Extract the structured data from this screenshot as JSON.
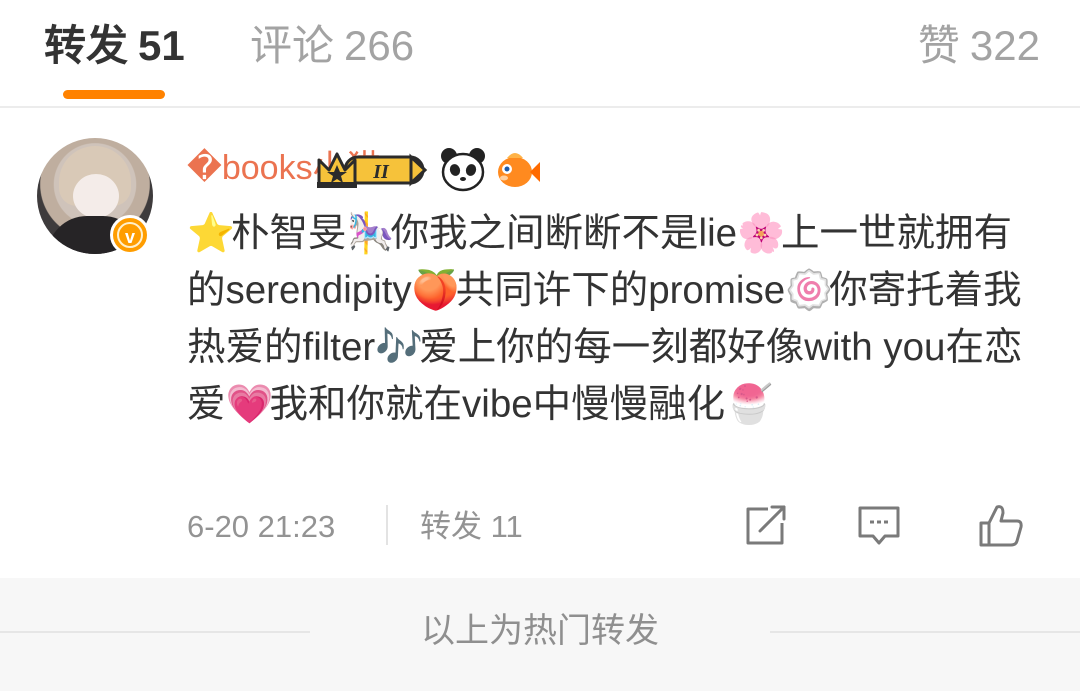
{
  "tabs": {
    "repost": {
      "label": "转发",
      "count": "51"
    },
    "comment": {
      "label": "评论",
      "count": "266"
    },
    "like": {
      "label": "赞",
      "count": "322"
    },
    "accent_color": "#ff8200"
  },
  "post": {
    "username": "�books小猫",
    "username_color": "#eb7350",
    "badges": [
      "crown-level-badge",
      "panda-icon",
      "fish-icon"
    ],
    "badge_level_text": "II",
    "verified_mark": "v",
    "content": {
      "seg1": "朴智旻",
      "seg2": "你我之间断断不是lie",
      "seg3": "上一世就拥有的serendipity",
      "seg4": "共同许下的promise",
      "seg5": "你寄托着我热爱的filter",
      "seg6": "爱上你的每一刻都好像with you在恋爱",
      "seg7": "我和你就在vibe中慢慢融化"
    },
    "emoji": {
      "star": "⭐",
      "carousel": "🎠",
      "blossom": "🌸",
      "peach": "🍑",
      "naruto": "🍥",
      "notes": "🎶",
      "heart": "💗",
      "shaved_ice": "🍧"
    },
    "time": "6-20 21:23",
    "repost_label": "转发 11"
  },
  "footer": {
    "label": "以上为热门转发"
  }
}
